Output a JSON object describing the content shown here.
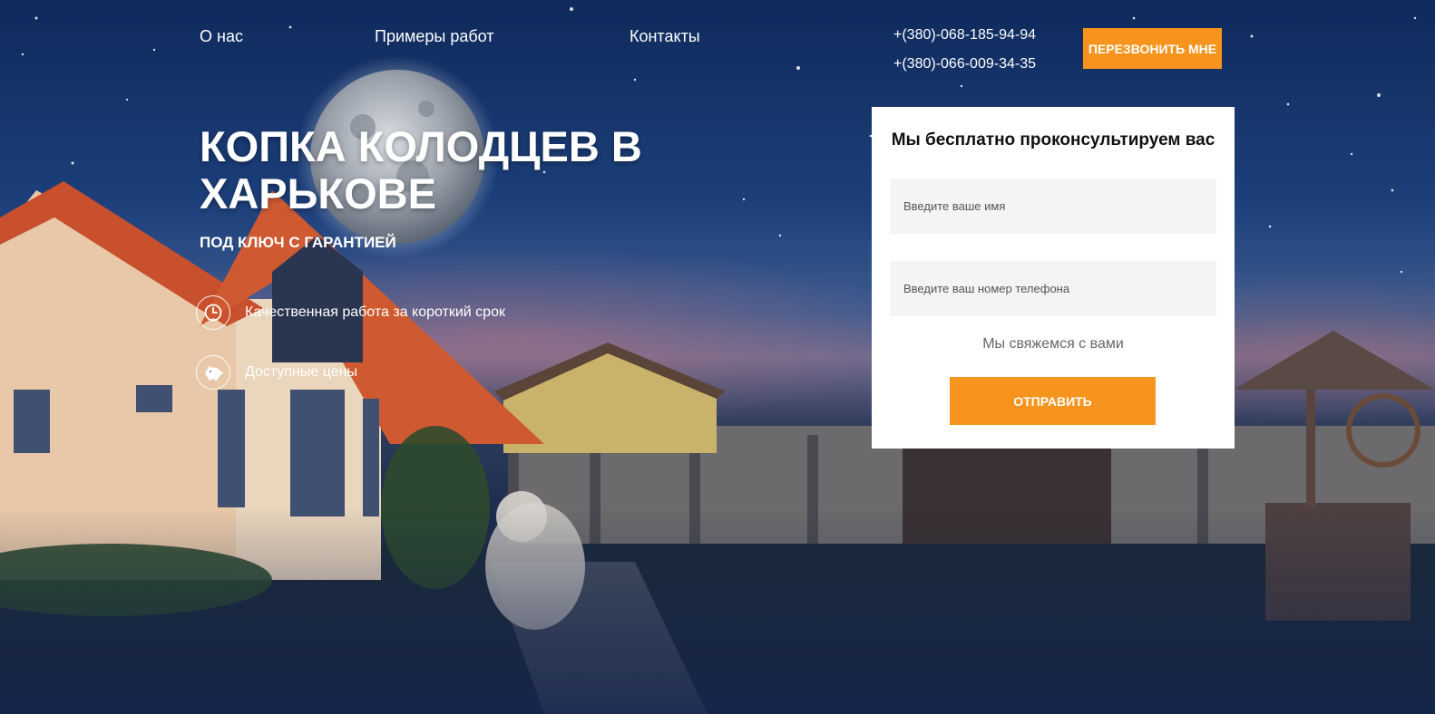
{
  "nav": {
    "items": [
      "О нас",
      "Примеры работ",
      "Контакты"
    ]
  },
  "contacts": {
    "phone1": "+(380)-068-185-94-94",
    "phone2": "+(380)-066-009-34-35",
    "callback_label": "ПЕРЕЗВОНИТЬ МНЕ"
  },
  "hero": {
    "title": "КОПКА КОЛОДЦЕВ В ХАРЬКОВЕ",
    "subtitle": "ПОД КЛЮЧ С ГАРАНТИЕЙ",
    "features": [
      {
        "icon": "clock-icon",
        "text": "Качественная работа за короткий срок"
      },
      {
        "icon": "piggy-bank-icon",
        "text": "Доступные цены"
      }
    ]
  },
  "form": {
    "title": "Мы бесплатно проконсультируем вас",
    "name_placeholder": "Введите ваше имя",
    "phone_placeholder": "Введите ваш номер телефона",
    "note": "Мы свяжемся с вами",
    "submit_label": "ОТПРАВИТЬ"
  },
  "colors": {
    "accent": "#f7941d",
    "sky_top": "#0f2a5c",
    "card_bg": "#ffffff"
  }
}
